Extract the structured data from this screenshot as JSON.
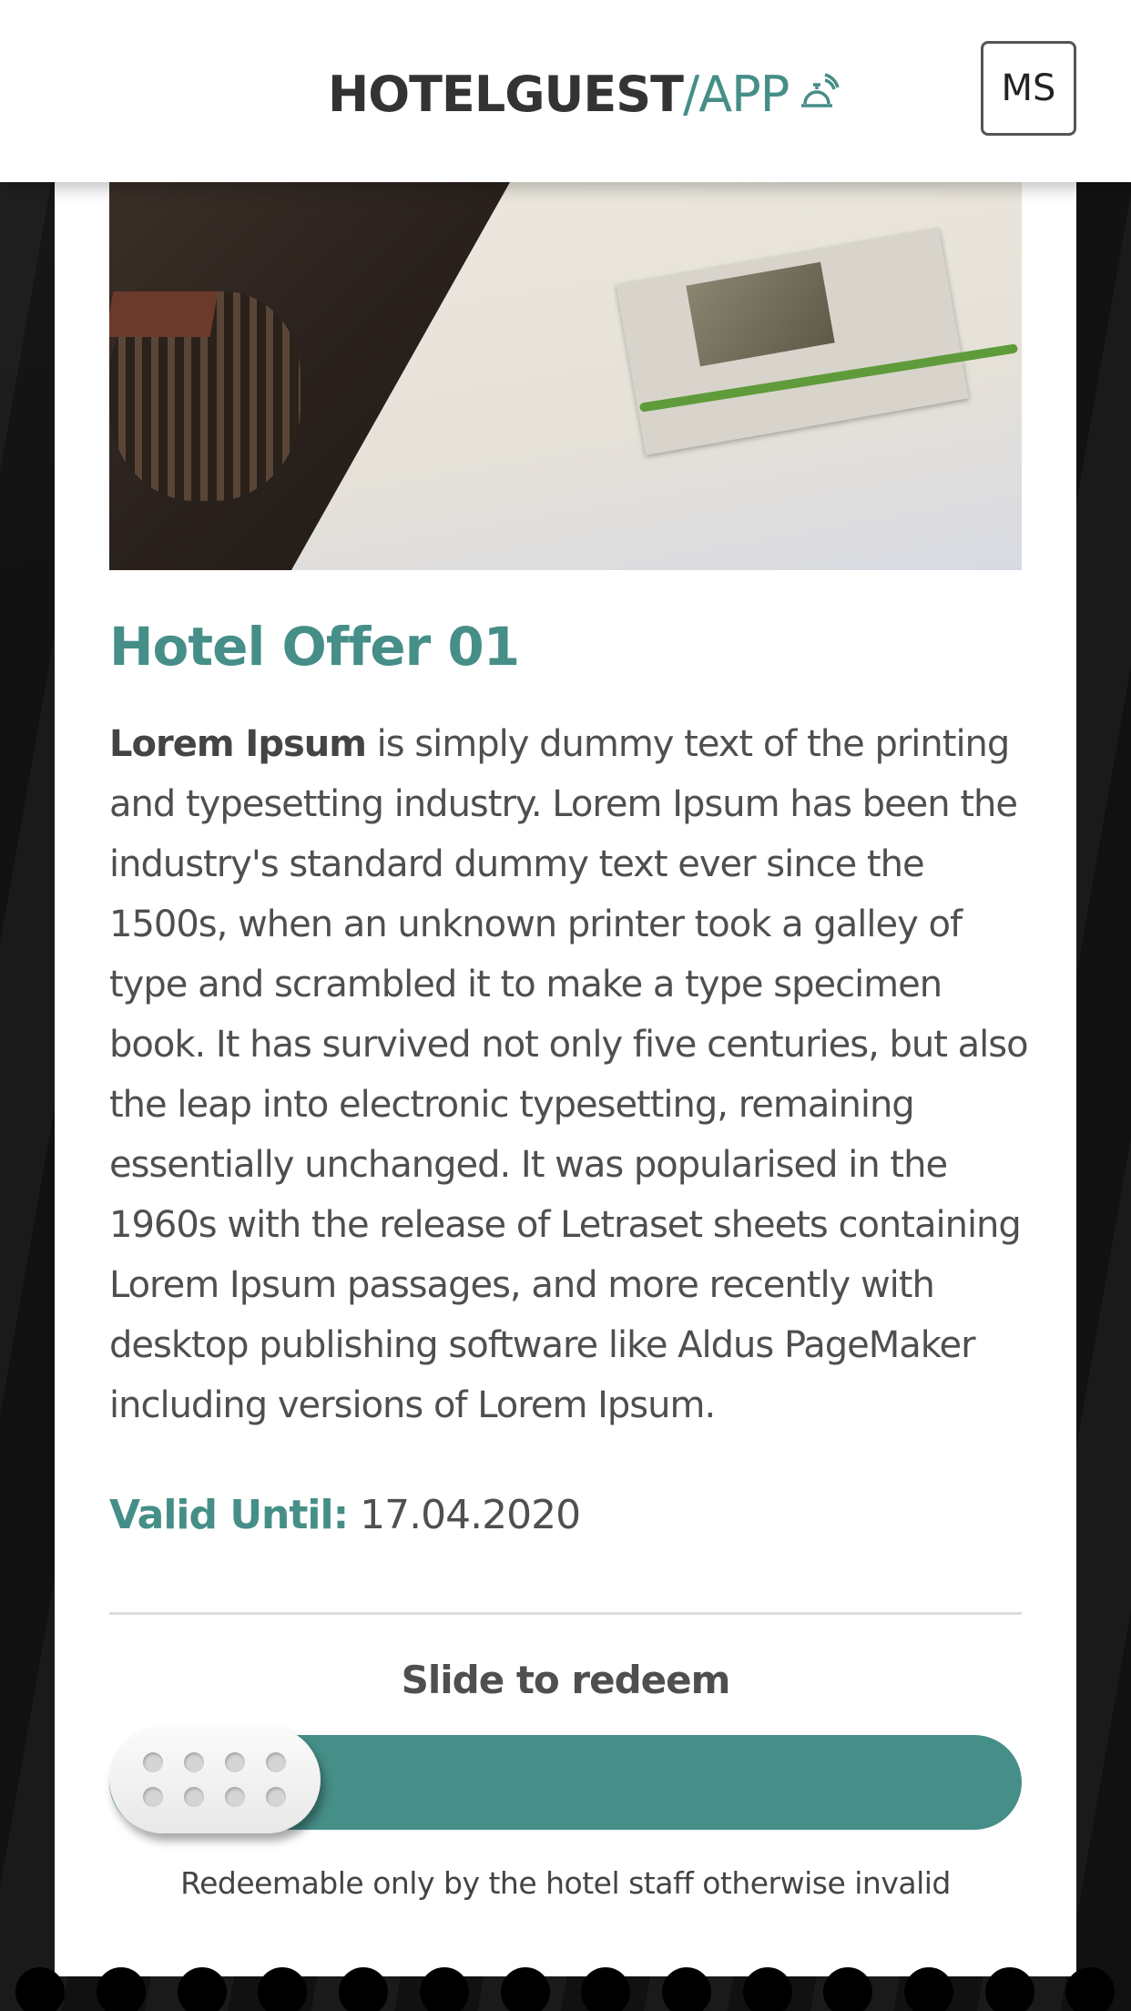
{
  "header": {
    "logo_part1": "HOTELGUEST",
    "logo_part2": "/APP",
    "logo_icon": "service-bell-icon",
    "user_initials": "MS"
  },
  "offer": {
    "title": "Hotel Offer 01",
    "description_bold": "Lorem Ipsum",
    "description_rest": " is simply dummy text of the printing and typesetting industry. Lorem Ipsum has been the industry's standard dummy text ever since the 1500s, when an unknown printer took a galley of type and scrambled it to make a type specimen book. It has survived not only five centuries, but also the leap into electronic typesetting, remaining essentially unchanged. It was popularised in the 1960s with the release of Letraset sheets containing Lorem Ipsum passages, and more recently with desktop publishing software like Aldus PageMaker including versions of Lorem Ipsum.",
    "valid_label": "Valid Until:",
    "valid_date": "17.04.2020"
  },
  "redeem": {
    "slide_label": "Slide to redeem",
    "note": "Redeemable only by the hotel staff otherwise invalid",
    "progress": 0
  },
  "colors": {
    "accent": "#468e88",
    "text": "#4f4f4f"
  }
}
